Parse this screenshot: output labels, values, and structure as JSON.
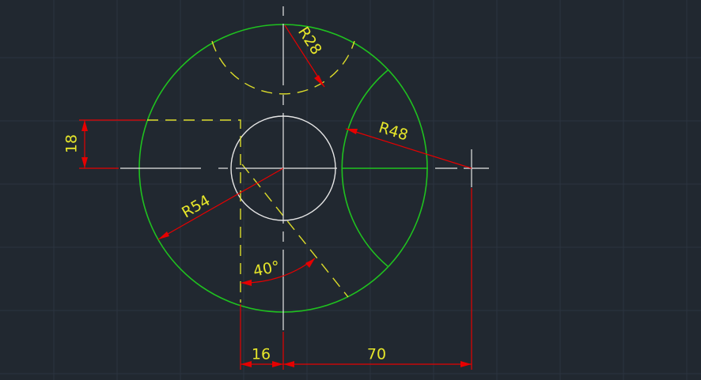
{
  "drawing": {
    "colors": {
      "background": "#212830",
      "grid": "#2c3440",
      "outline": "#1fc21f",
      "hidden": "#dcdc2a",
      "center": "#e6e6e6",
      "dimension": "#e60000",
      "text": "#e6e62a"
    },
    "dimensions": {
      "radius_small": "R28",
      "radius_medium": "R48",
      "radius_large": "R54",
      "height": "18",
      "angle": "40°",
      "offset_left": "16",
      "offset_right": "70"
    }
  }
}
